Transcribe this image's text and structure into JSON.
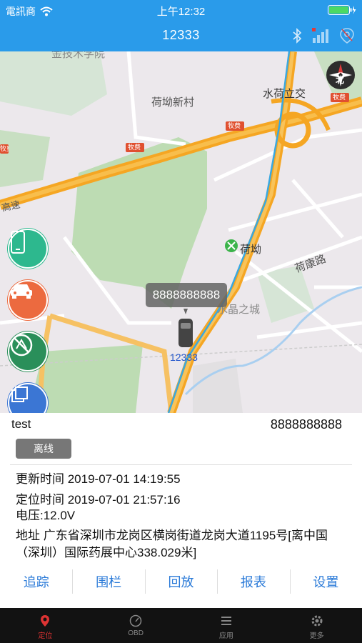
{
  "status_bar": {
    "carrier": "電訊商",
    "time": "上午12:32"
  },
  "header": {
    "title": "12333"
  },
  "map": {
    "labels": [
      "荷坳新村",
      "水荷立交",
      "荷坳",
      "荷康路",
      "水晶之城",
      "金技术学院",
      "高速",
      "12333"
    ],
    "road_signs": [
      "牧费",
      "牧费",
      "牧费",
      "牧费"
    ],
    "compass": "北",
    "vehicle_bubble": "8888888888",
    "vehicle_label": "12333"
  },
  "info": {
    "name": "test",
    "device_id": "8888888888",
    "status_badge": "离线",
    "update_time": "更新时间 2019-07-01 14:19:55",
    "locate_time": "定位时间 2019-07-01 21:57:16",
    "voltage": "电压:12.0V",
    "address": "地址 广东省深圳市龙岗区横岗街道龙岗大道1195号[离中国（深圳）国际药展中心338.029米]"
  },
  "actions": [
    "追踪",
    "围栏",
    "回放",
    "报表",
    "设置"
  ],
  "tabs": [
    "定位",
    "OBD",
    "应用",
    "更多"
  ],
  "colors": {
    "accent": "#2a9bea",
    "action_text": "#2a7ad8",
    "active_tab": "#dd3333"
  }
}
